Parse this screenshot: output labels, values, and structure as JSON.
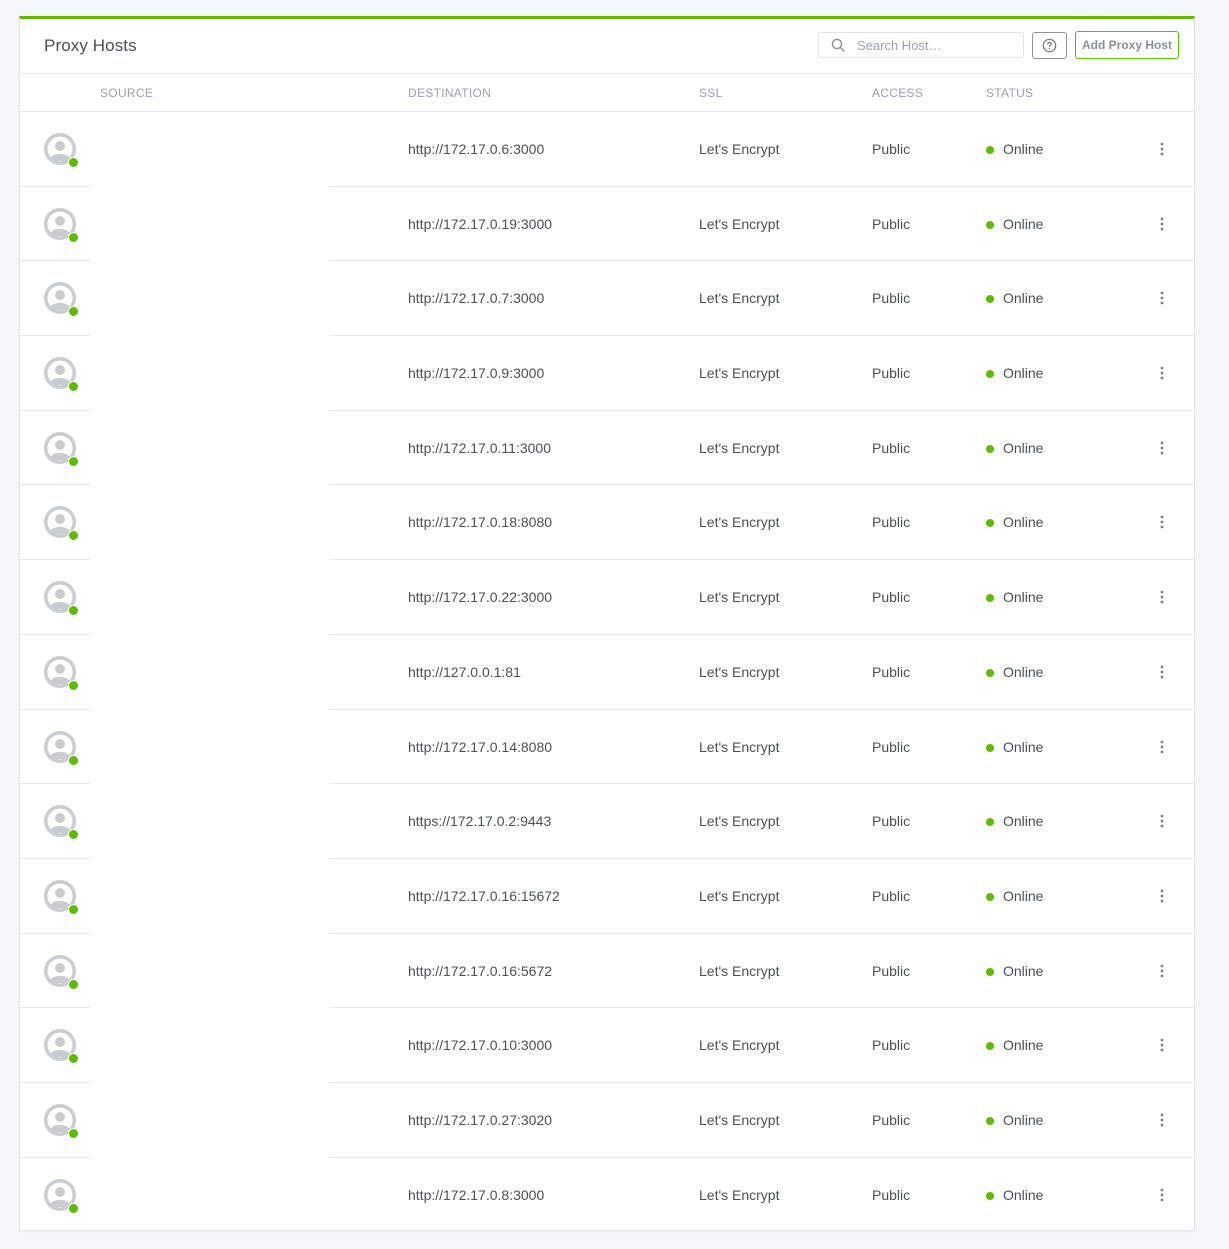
{
  "header": {
    "title": "Proxy Hosts",
    "search_placeholder": "Search Host…",
    "add_button_label": "Add Proxy Host"
  },
  "columns": {
    "source": "SOURCE",
    "destination": "DESTINATION",
    "ssl": "SSL",
    "access": "ACCESS",
    "status": "STATUS"
  },
  "icons": {
    "search": "search-icon",
    "help": "help-circle-icon",
    "avatar": "user-avatar-icon",
    "menu": "more-vertical-icon"
  },
  "colors": {
    "accent": "#5eba00",
    "border": "#e6e9ef",
    "muted": "#9aa0ac",
    "text": "#495057"
  },
  "rows": [
    {
      "destination": "http://172.17.0.6:3000",
      "ssl": "Let's Encrypt",
      "access": "Public",
      "status": "Online"
    },
    {
      "destination": "http://172.17.0.19:3000",
      "ssl": "Let's Encrypt",
      "access": "Public",
      "status": "Online"
    },
    {
      "destination": "http://172.17.0.7:3000",
      "ssl": "Let's Encrypt",
      "access": "Public",
      "status": "Online"
    },
    {
      "destination": "http://172.17.0.9:3000",
      "ssl": "Let's Encrypt",
      "access": "Public",
      "status": "Online"
    },
    {
      "destination": "http://172.17.0.11:3000",
      "ssl": "Let's Encrypt",
      "access": "Public",
      "status": "Online"
    },
    {
      "destination": "http://172.17.0.18:8080",
      "ssl": "Let's Encrypt",
      "access": "Public",
      "status": "Online"
    },
    {
      "destination": "http://172.17.0.22:3000",
      "ssl": "Let's Encrypt",
      "access": "Public",
      "status": "Online"
    },
    {
      "destination": "http://127.0.0.1:81",
      "ssl": "Let's Encrypt",
      "access": "Public",
      "status": "Online"
    },
    {
      "destination": "http://172.17.0.14:8080",
      "ssl": "Let's Encrypt",
      "access": "Public",
      "status": "Online"
    },
    {
      "destination": "https://172.17.0.2:9443",
      "ssl": "Let's Encrypt",
      "access": "Public",
      "status": "Online"
    },
    {
      "destination": "http://172.17.0.16:15672",
      "ssl": "Let's Encrypt",
      "access": "Public",
      "status": "Online"
    },
    {
      "destination": "http://172.17.0.16:5672",
      "ssl": "Let's Encrypt",
      "access": "Public",
      "status": "Online"
    },
    {
      "destination": "http://172.17.0.10:3000",
      "ssl": "Let's Encrypt",
      "access": "Public",
      "status": "Online"
    },
    {
      "destination": "http://172.17.0.27:3020",
      "ssl": "Let's Encrypt",
      "access": "Public",
      "status": "Online"
    },
    {
      "destination": "http://172.17.0.8:3000",
      "ssl": "Let's Encrypt",
      "access": "Public",
      "status": "Online"
    }
  ]
}
